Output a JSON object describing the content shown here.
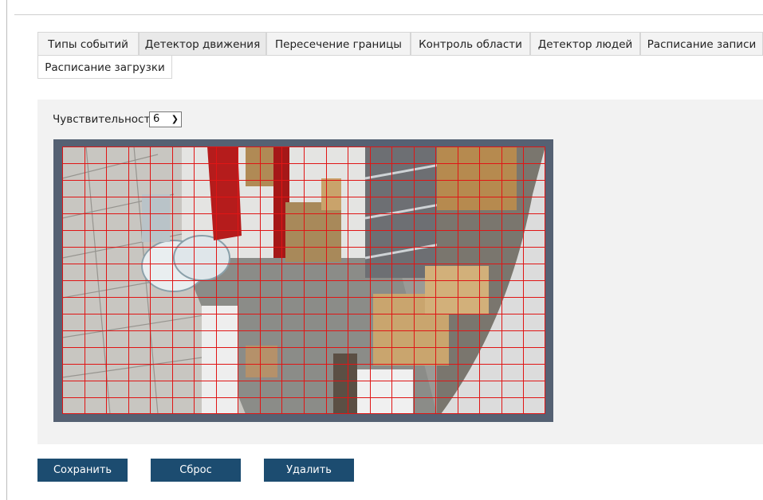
{
  "tabs_row1": [
    {
      "label": "Типы событий",
      "active": false
    },
    {
      "label": "Детектор движения",
      "active": true
    },
    {
      "label": "Пересечение границы",
      "active": false
    },
    {
      "label": "Контроль области",
      "active": false
    },
    {
      "label": "Детектор людей",
      "active": false
    },
    {
      "label": "Расписание записи",
      "active": false
    }
  ],
  "tabs_row2": [
    {
      "label": "Расписание загрузки",
      "active": false
    }
  ],
  "sensitivity": {
    "label": "Чувствительность",
    "value": "6"
  },
  "detection_grid": {
    "columns": 22,
    "rows": 16,
    "color": "#e01515"
  },
  "buttons": {
    "save": "Сохранить",
    "reset": "Сброс",
    "delete": "Удалить"
  },
  "colors": {
    "button_bg": "#1c4c70",
    "frame": "#556173"
  }
}
